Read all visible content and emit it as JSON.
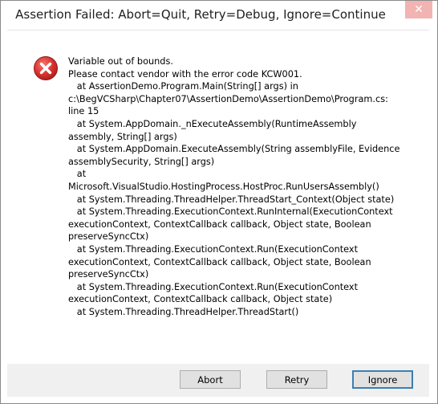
{
  "window": {
    "title": "Assertion Failed: Abort=Quit, Retry=Debug, Ignore=Continue",
    "close_glyph": "✕"
  },
  "icon": {
    "name": "error-icon",
    "color": "#d9302c"
  },
  "message": {
    "text": "Variable out of bounds.\nPlease contact vendor with the error code KCW001.\n   at AssertionDemo.Program.Main(String[] args) in\nc:\\BegVCSharp\\Chapter07\\AssertionDemo\\AssertionDemo\\Program.cs:\nline 15\n   at System.AppDomain._nExecuteAssembly(RuntimeAssembly\nassembly, String[] args)\n   at System.AppDomain.ExecuteAssembly(String assemblyFile, Evidence\nassemblySecurity, String[] args)\n   at\nMicrosoft.VisualStudio.HostingProcess.HostProc.RunUsersAssembly()\n   at System.Threading.ThreadHelper.ThreadStart_Context(Object state)\n   at System.Threading.ExecutionContext.RunInternal(ExecutionContext\nexecutionContext, ContextCallback callback, Object state, Boolean\npreserveSyncCtx)\n   at System.Threading.ExecutionContext.Run(ExecutionContext\nexecutionContext, ContextCallback callback, Object state, Boolean\npreserveSyncCtx)\n   at System.Threading.ExecutionContext.Run(ExecutionContext\nexecutionContext, ContextCallback callback, Object state)\n   at System.Threading.ThreadHelper.ThreadStart()"
  },
  "buttons": {
    "abort_label": "Abort",
    "retry_label": "Retry",
    "ignore_label": "Ignore"
  }
}
